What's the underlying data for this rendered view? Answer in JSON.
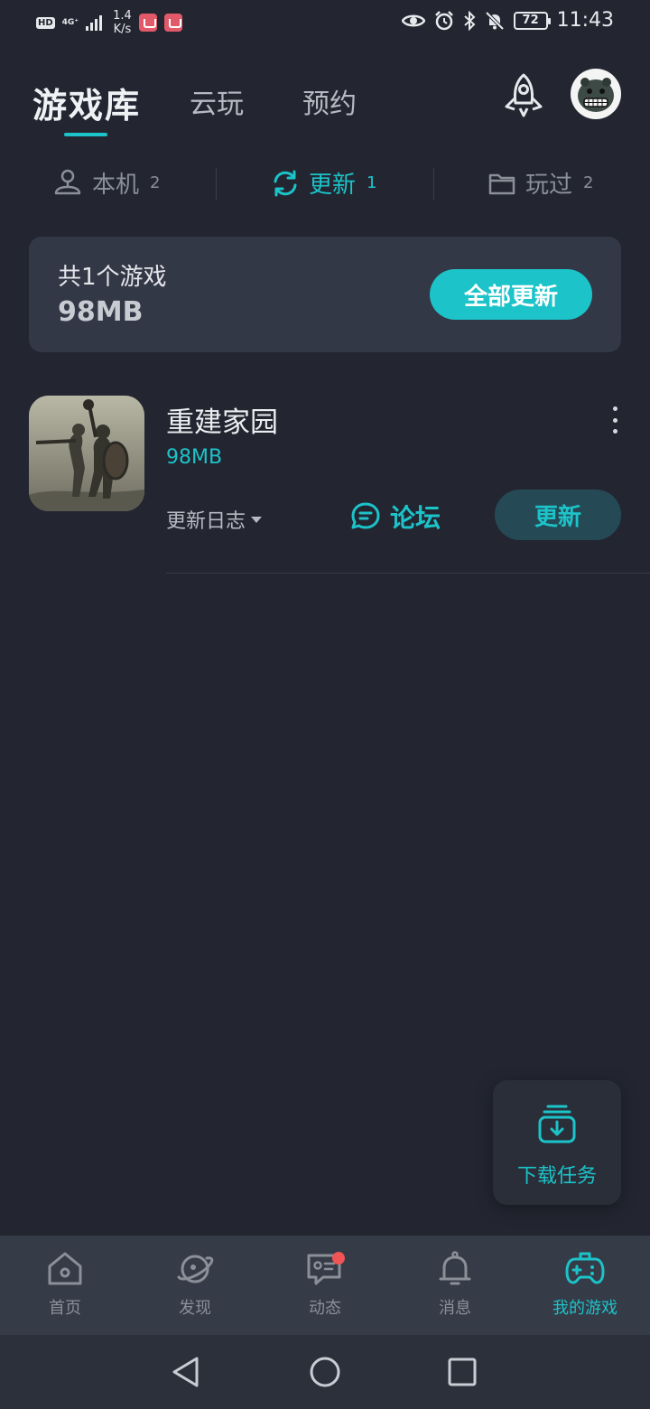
{
  "status_bar": {
    "hd": "HD",
    "network": "4G⁺",
    "speed_value": "1.4",
    "speed_unit": "K/s",
    "battery": "72",
    "time": "11:43"
  },
  "header": {
    "main_tab": "游戏库",
    "tabs": [
      "云玩",
      "预约"
    ]
  },
  "sub_tabs": [
    {
      "label": "本机",
      "count": "2"
    },
    {
      "label": "更新",
      "count": "1"
    },
    {
      "label": "玩过",
      "count": "2"
    }
  ],
  "summary": {
    "count_text": "共1个游戏",
    "total_size": "98MB",
    "update_all_label": "全部更新"
  },
  "game": {
    "name": "重建家园",
    "size": "98MB",
    "changelog_label": "更新日志",
    "forum_label": "论坛",
    "update_label": "更新"
  },
  "download_tasks": {
    "label": "下载任务"
  },
  "bottom_nav": [
    {
      "label": "首页"
    },
    {
      "label": "发现"
    },
    {
      "label": "动态"
    },
    {
      "label": "消息"
    },
    {
      "label": "我的游戏"
    }
  ],
  "colors": {
    "background": "#232631",
    "accent": "#1cc3c9",
    "card": "#333846",
    "nav_bar": "#363b48"
  }
}
